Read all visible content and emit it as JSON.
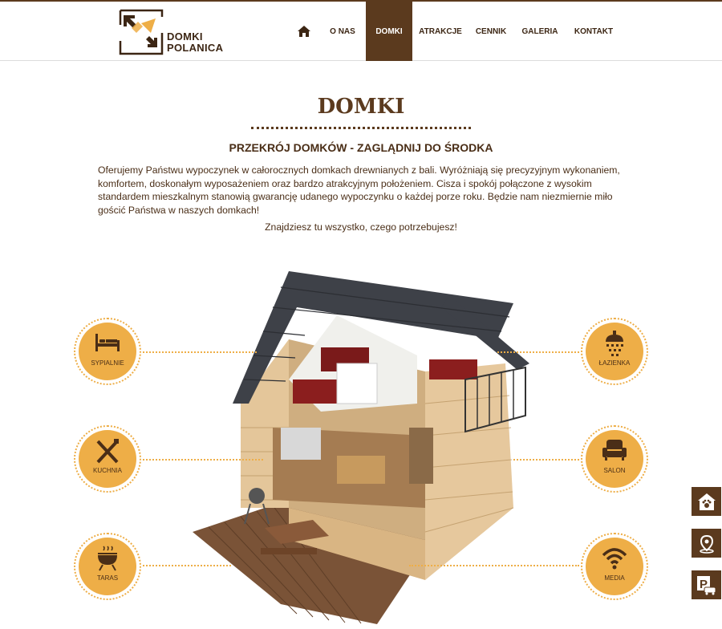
{
  "header": {
    "logo": {
      "line1": "DOMKI",
      "line2": "POLANICA"
    },
    "nav": [
      {
        "label": "O NAS"
      },
      {
        "label": "DOMKI"
      },
      {
        "label": "ATRAKCJE"
      },
      {
        "label": "CENNIK"
      },
      {
        "label": "GALERIA"
      },
      {
        "label": "KONTAKT"
      }
    ],
    "active_item": "DOMKI",
    "home_icon": "home-icon"
  },
  "main": {
    "title": "DOMKI",
    "subtitle": "PRZEKRÓJ DOMKÓW - ZAGLĄDNIJ DO ŚRODKA",
    "paragraph": "Oferujemy Państwu wypoczynek w całorocznych domkach drewnianych z bali. Wyróżniają się precyzyjnym wykonaniem, komfortem, doskonałym wyposażeniem oraz bardzo atrakcyjnym położeniem. Cisza i spokój połączone z wysokim standardem mieszkalnym stanowią gwarancję udanego wypoczynku o każdej porze roku. Będzie nam niezmiernie miło gościć Państwa w naszych domkach!",
    "tagline": "Znajdziesz tu wszystko, czego potrzebujesz!"
  },
  "features": {
    "left": [
      {
        "label": "SYPIALNIE",
        "icon": "bed-icon"
      },
      {
        "label": "KUCHNIA",
        "icon": "cutlery-icon"
      },
      {
        "label": "TARAS",
        "icon": "grill-icon"
      }
    ],
    "right": [
      {
        "label": "ŁAZIENKA",
        "icon": "shower-icon"
      },
      {
        "label": "SALON",
        "icon": "armchair-icon"
      },
      {
        "label": "MEDIA",
        "icon": "wifi-icon"
      }
    ]
  },
  "side_buttons": [
    {
      "icon": "pet-friendly-icon"
    },
    {
      "icon": "location-pin-icon"
    },
    {
      "icon": "parking-icon"
    }
  ],
  "colors": {
    "brand_brown": "#5b3a1e",
    "accent_orange": "#eeae47",
    "text": "#4a2e17"
  }
}
